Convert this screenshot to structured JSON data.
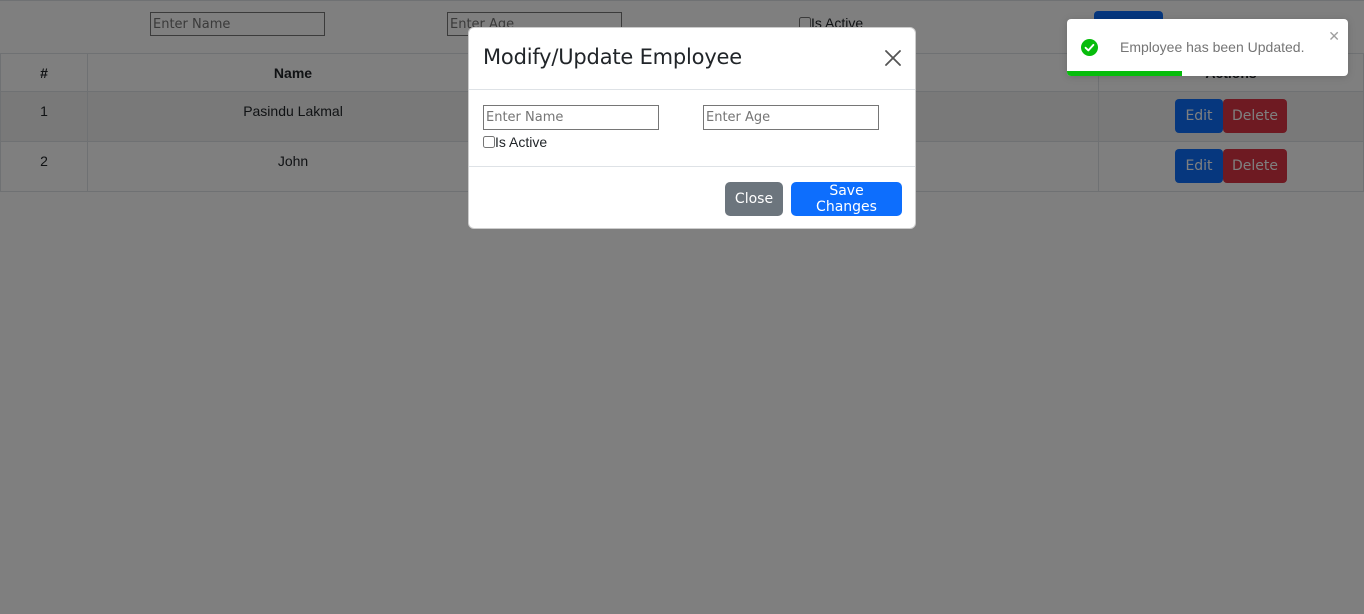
{
  "form": {
    "name_placeholder": "Enter Name",
    "age_placeholder": "Enter Age",
    "active_label": "Is Active"
  },
  "table": {
    "columns": [
      "#",
      "Name",
      "",
      "",
      "Actions"
    ],
    "rows": [
      {
        "index": "1",
        "name": "Pasindu Lakmal"
      },
      {
        "index": "2",
        "name": "John"
      }
    ],
    "edit_label": "Edit",
    "delete_label": "Delete"
  },
  "modal": {
    "title": "Modify/Update Employee",
    "name_placeholder": "Enter Name",
    "age_placeholder": "Enter Age",
    "active_label": "Is Active",
    "close_label": "Close",
    "save_label": "Save Changes",
    "close_icon": "close-icon"
  },
  "toast": {
    "message": "Employee has been Updated.",
    "icon": "check-circle-icon",
    "close_glyph": "✕",
    "progress_fraction": 0.41,
    "colors": {
      "success": "#07bc0c"
    }
  },
  "colors": {
    "primary": "#0d6efd",
    "danger": "#dc3545",
    "secondary": "#6c757d"
  }
}
